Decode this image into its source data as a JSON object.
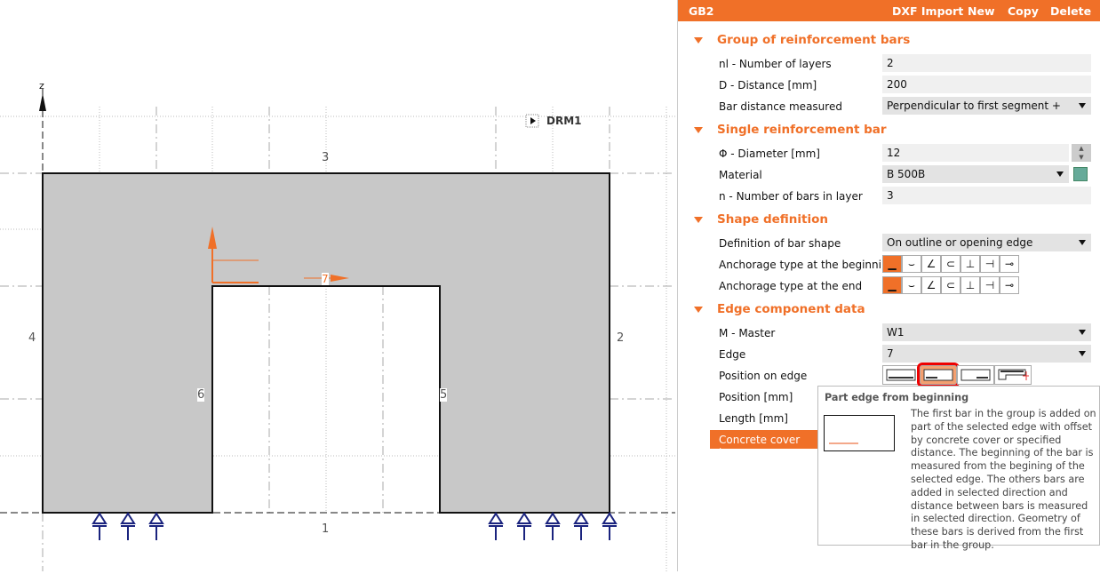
{
  "canvas": {
    "axis_label": "z",
    "view_label": "DRM1",
    "edge_labels": {
      "e1": "1",
      "e2": "2",
      "e3": "3",
      "e4": "4",
      "e5": "5",
      "e6": "6",
      "e7": "7"
    }
  },
  "header": {
    "title": "GB2",
    "dxf_import": "DXF Import",
    "new": "New",
    "copy": "Copy",
    "delete": "Delete"
  },
  "sections": {
    "group": {
      "title": "Group of reinforcement bars",
      "nl_label": "nl - Number of layers",
      "nl_value": "2",
      "d_label": "D - Distance [mm]",
      "d_value": "200",
      "measured_label": "Bar distance measured",
      "measured_value": "Perpendicular to first segment +"
    },
    "single": {
      "title": "Single reinforcement bar",
      "dia_label": "Φ - Diameter [mm]",
      "dia_value": "12",
      "material_label": "Material",
      "material_value": "B 500B",
      "n_label": "n - Number of bars in layer",
      "n_value": "3"
    },
    "shape": {
      "title": "Shape definition",
      "def_label": "Definition of bar shape",
      "def_value": "On outline or opening edge",
      "anch_begin_label": "Anchorage type at the beginning",
      "anch_end_label": "Anchorage type at the end"
    },
    "edge": {
      "title": "Edge component data",
      "master_label": "M - Master",
      "master_value": "W1",
      "edge_label": "Edge",
      "edge_value": "7",
      "pos_edge_label": "Position on edge",
      "position_label": "Position [mm]",
      "length_label": "Length [mm]",
      "cover_label": "Concrete cover type"
    }
  },
  "tooltip": {
    "title": "Part edge from beginning",
    "text": "The first bar in the group is added on part of the selected edge with offset by concrete cover or specified distance. The beginning of the bar is measured from the begining of the selected edge. The others bars are added in selected direction and distance between bars is measured in selected direction. Geometry of these bars is derived from the first bar in the group."
  },
  "colors": {
    "accent": "#f07028"
  }
}
